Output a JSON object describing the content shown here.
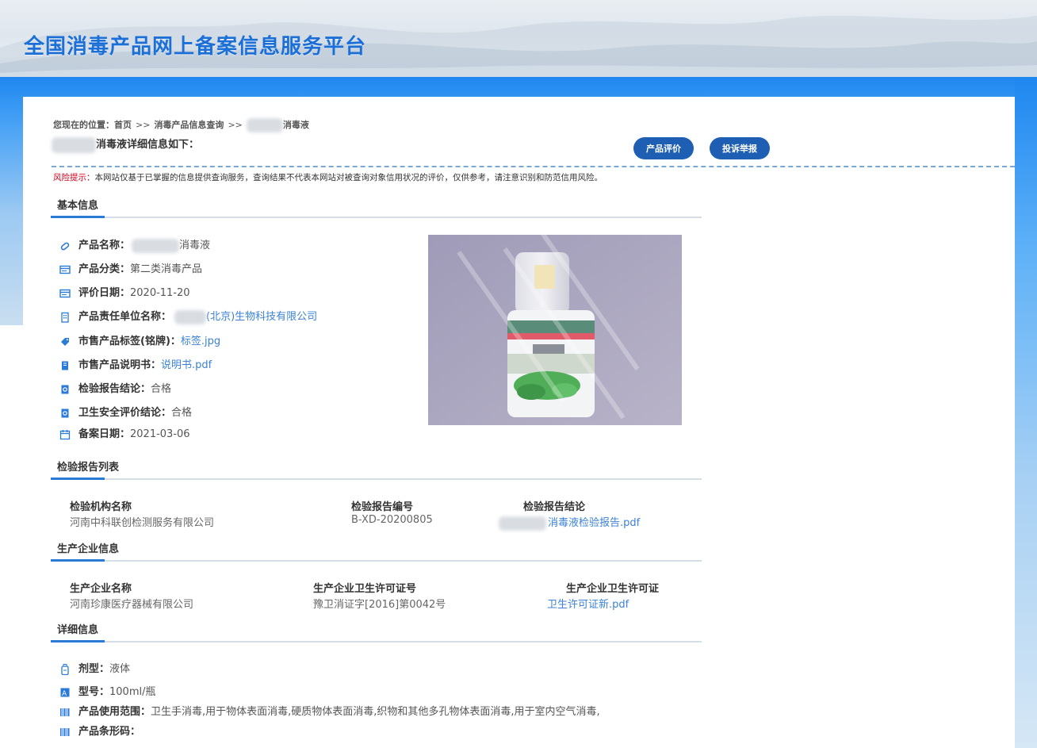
{
  "header": {
    "site_title": "全国消毒产品网上备案信息服务平台"
  },
  "breadcrumb": {
    "prefix": "您现在的位置：",
    "home": "首页",
    "separator": ">>",
    "query": "消毒产品信息查询",
    "current_suffix": "消毒液"
  },
  "detail_title_suffix": "消毒液详细信息如下：",
  "buttons": {
    "evaluate": "产品评价",
    "complaint": "投诉举报"
  },
  "risk": {
    "label": "风险提示：",
    "text": "本网站仅基于已掌握的信息提供查询服务，查询结果不代表本网站对被查询对象信用状况的评价，仅供参考，请注意识别和防范信用风险。"
  },
  "basic": {
    "section_title": "基本信息",
    "product_name_label": "产品名称：",
    "product_name_suffix": "消毒液",
    "category_label": "产品分类：",
    "category": "第二类消毒产品",
    "eval_date_label": "评价日期：",
    "eval_date": "2020-11-20",
    "company_label": "产品责任单位名称：",
    "company_suffix": "(北京)生物科技有限公司",
    "tag_label": "市售产品标签(铭牌)：",
    "tag_file": "标签.jpg",
    "manual_label": "市售产品说明书：",
    "manual_file": "说明书.pdf",
    "inspection_label": "检验报告结论：",
    "inspection": "合格",
    "safety_label": "卫生安全评价结论：",
    "safety": "合格",
    "record_date_label": "备案日期：",
    "record_date": "2021-03-06"
  },
  "reports": {
    "section_title": "检验报告列表",
    "columns": [
      "检验机构名称",
      "检验报告编号",
      "检验报告结论"
    ],
    "rows": [
      {
        "org": "河南中科联创检测服务有限公司",
        "number": "B-XD-20200805",
        "conclusion_suffix": "消毒液检验报告.pdf"
      }
    ]
  },
  "manufacturer": {
    "section_title": "生产企业信息",
    "columns": [
      "生产企业名称",
      "生产企业卫生许可证号",
      "生产企业卫生许可证"
    ],
    "name": "河南珍康医疗器械有限公司",
    "license_no": "豫卫消证字[2016]第0042号",
    "license_file": "卫生许可证新.pdf"
  },
  "details": {
    "section_title": "详细信息",
    "form_label": "剂型：",
    "form": "液体",
    "model_label": "型号：",
    "model": "100ml/瓶",
    "scope_label": "产品使用范围：",
    "scope": "卫生手消毒,用于物体表面消毒,硬质物体表面消毒,织物和其他多孔物体表面消毒,用于室内空气消毒,",
    "barcode_label": "产品条形码："
  },
  "colors": {
    "brand_blue": "#1c6fd6",
    "button_blue": "#1e5fb4",
    "link_blue": "#3b82d6",
    "risk_red": "#d9001b"
  }
}
